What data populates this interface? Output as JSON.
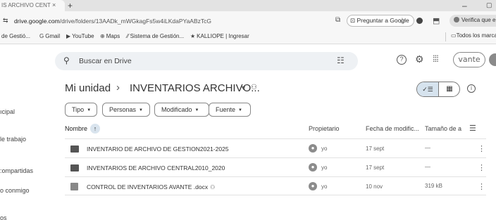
{
  "browser": {
    "tab_title": "IS ARCHIVO CENT",
    "tab_close": "×",
    "new_tab": "+",
    "url_host": "drive.google.com",
    "url_path": "/drive/folders/13AADk_mWGkagFs5w4iLKdaPYaABzTcG",
    "ask_google": "Preguntar a Google",
    "verify_label": "Verifica que eres tú",
    "minimize": "–",
    "maximize": "▢"
  },
  "bookmarks": {
    "items": [
      {
        "icon": "",
        "label": "de Gestió..."
      },
      {
        "icon": "G",
        "label": "Gmail"
      },
      {
        "icon": "▶",
        "label": "YouTube"
      },
      {
        "icon": "⊕",
        "label": "Maps"
      },
      {
        "icon": "⁄⁄",
        "label": "Sistema de Gestión..."
      },
      {
        "icon": "★",
        "label": "KALLIOPE | Ingresar"
      }
    ],
    "all_label": "Todos los marcad"
  },
  "drive": {
    "search_placeholder": "Buscar en Drive",
    "logo_text": "vante",
    "sidebar": [
      "ıcipal",
      "le trabajo",
      ":ompartidas",
      "o conmigo",
      "os"
    ],
    "breadcrumb": {
      "root": "Mi unidad",
      "current": "INVENTARIOS ARCHIVO..."
    },
    "filters": [
      "Tipo",
      "Personas",
      "Modificado",
      "Fuente"
    ],
    "columns": {
      "name": "Nombre",
      "owner": "Propietario",
      "modified": "Fecha de modific...",
      "size": "Tamaño de a"
    },
    "files": [
      {
        "type": "folder",
        "name": "INVENTARIO DE ARCHIVO DE GESTION2021-2025",
        "shared": false,
        "owner": "yo",
        "modified": "17 sept",
        "size": "—"
      },
      {
        "type": "folder",
        "name": "INVENTARIOS DE ARCHIVO CENTRAL2010_2020",
        "shared": false,
        "owner": "yo",
        "modified": "17 sept",
        "size": "—"
      },
      {
        "type": "docx",
        "name": "CONTROL DE INVENTARIOS AVANTE .docx",
        "shared": true,
        "owner": "yo",
        "modified": "10 nov",
        "size": "319 kB"
      }
    ]
  }
}
